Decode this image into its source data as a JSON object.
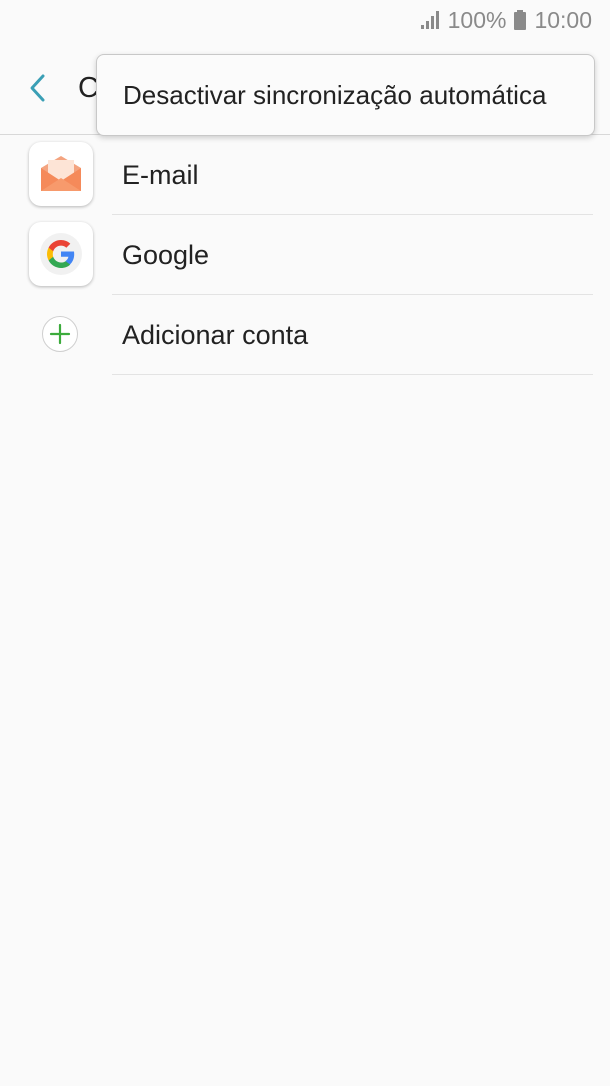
{
  "status_bar": {
    "battery_text": "100%",
    "time": "10:00",
    "icons": [
      "signal-icon",
      "battery-icon"
    ]
  },
  "header": {
    "title": "C",
    "back_icon": "chevron-left-icon",
    "accent_color": "#3a9fb5"
  },
  "popup_menu": {
    "items": [
      {
        "label": "Desactivar sincronização automática"
      }
    ]
  },
  "accounts": {
    "items": [
      {
        "label": "E-mail",
        "icon": "email-app-icon"
      },
      {
        "label": "Google",
        "icon": "google-icon"
      },
      {
        "label": "Adicionar conta",
        "icon": "add-icon"
      }
    ]
  }
}
